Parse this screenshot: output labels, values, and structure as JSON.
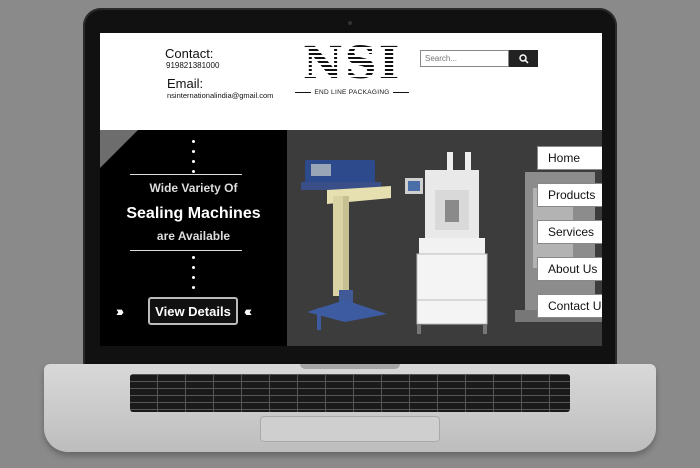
{
  "header": {
    "contact_label": "Contact:",
    "contact_phone": "919821381000",
    "email_label": "Email:",
    "email_value": "nsinternationalindia@gmail.com"
  },
  "logo": {
    "text": "NSI",
    "tagline": "END LINE PACKAGING"
  },
  "search": {
    "placeholder": "Search...",
    "icon": "search-icon"
  },
  "hero": {
    "line1": "Wide Variety Of",
    "line2": "Sealing Machines",
    "line3": "are Available",
    "button_label": "View Details",
    "left_chevrons": "›››",
    "right_chevrons": "‹‹‹"
  },
  "nav": {
    "items": [
      {
        "label": "Home"
      },
      {
        "label": "Products"
      },
      {
        "label": "Services"
      },
      {
        "label": "About Us"
      },
      {
        "label": "Contact Us"
      }
    ]
  },
  "colors": {
    "hero_bg": "#000000",
    "product_bg": "#3c3c3c",
    "page_bg": "#8a8a8a"
  }
}
